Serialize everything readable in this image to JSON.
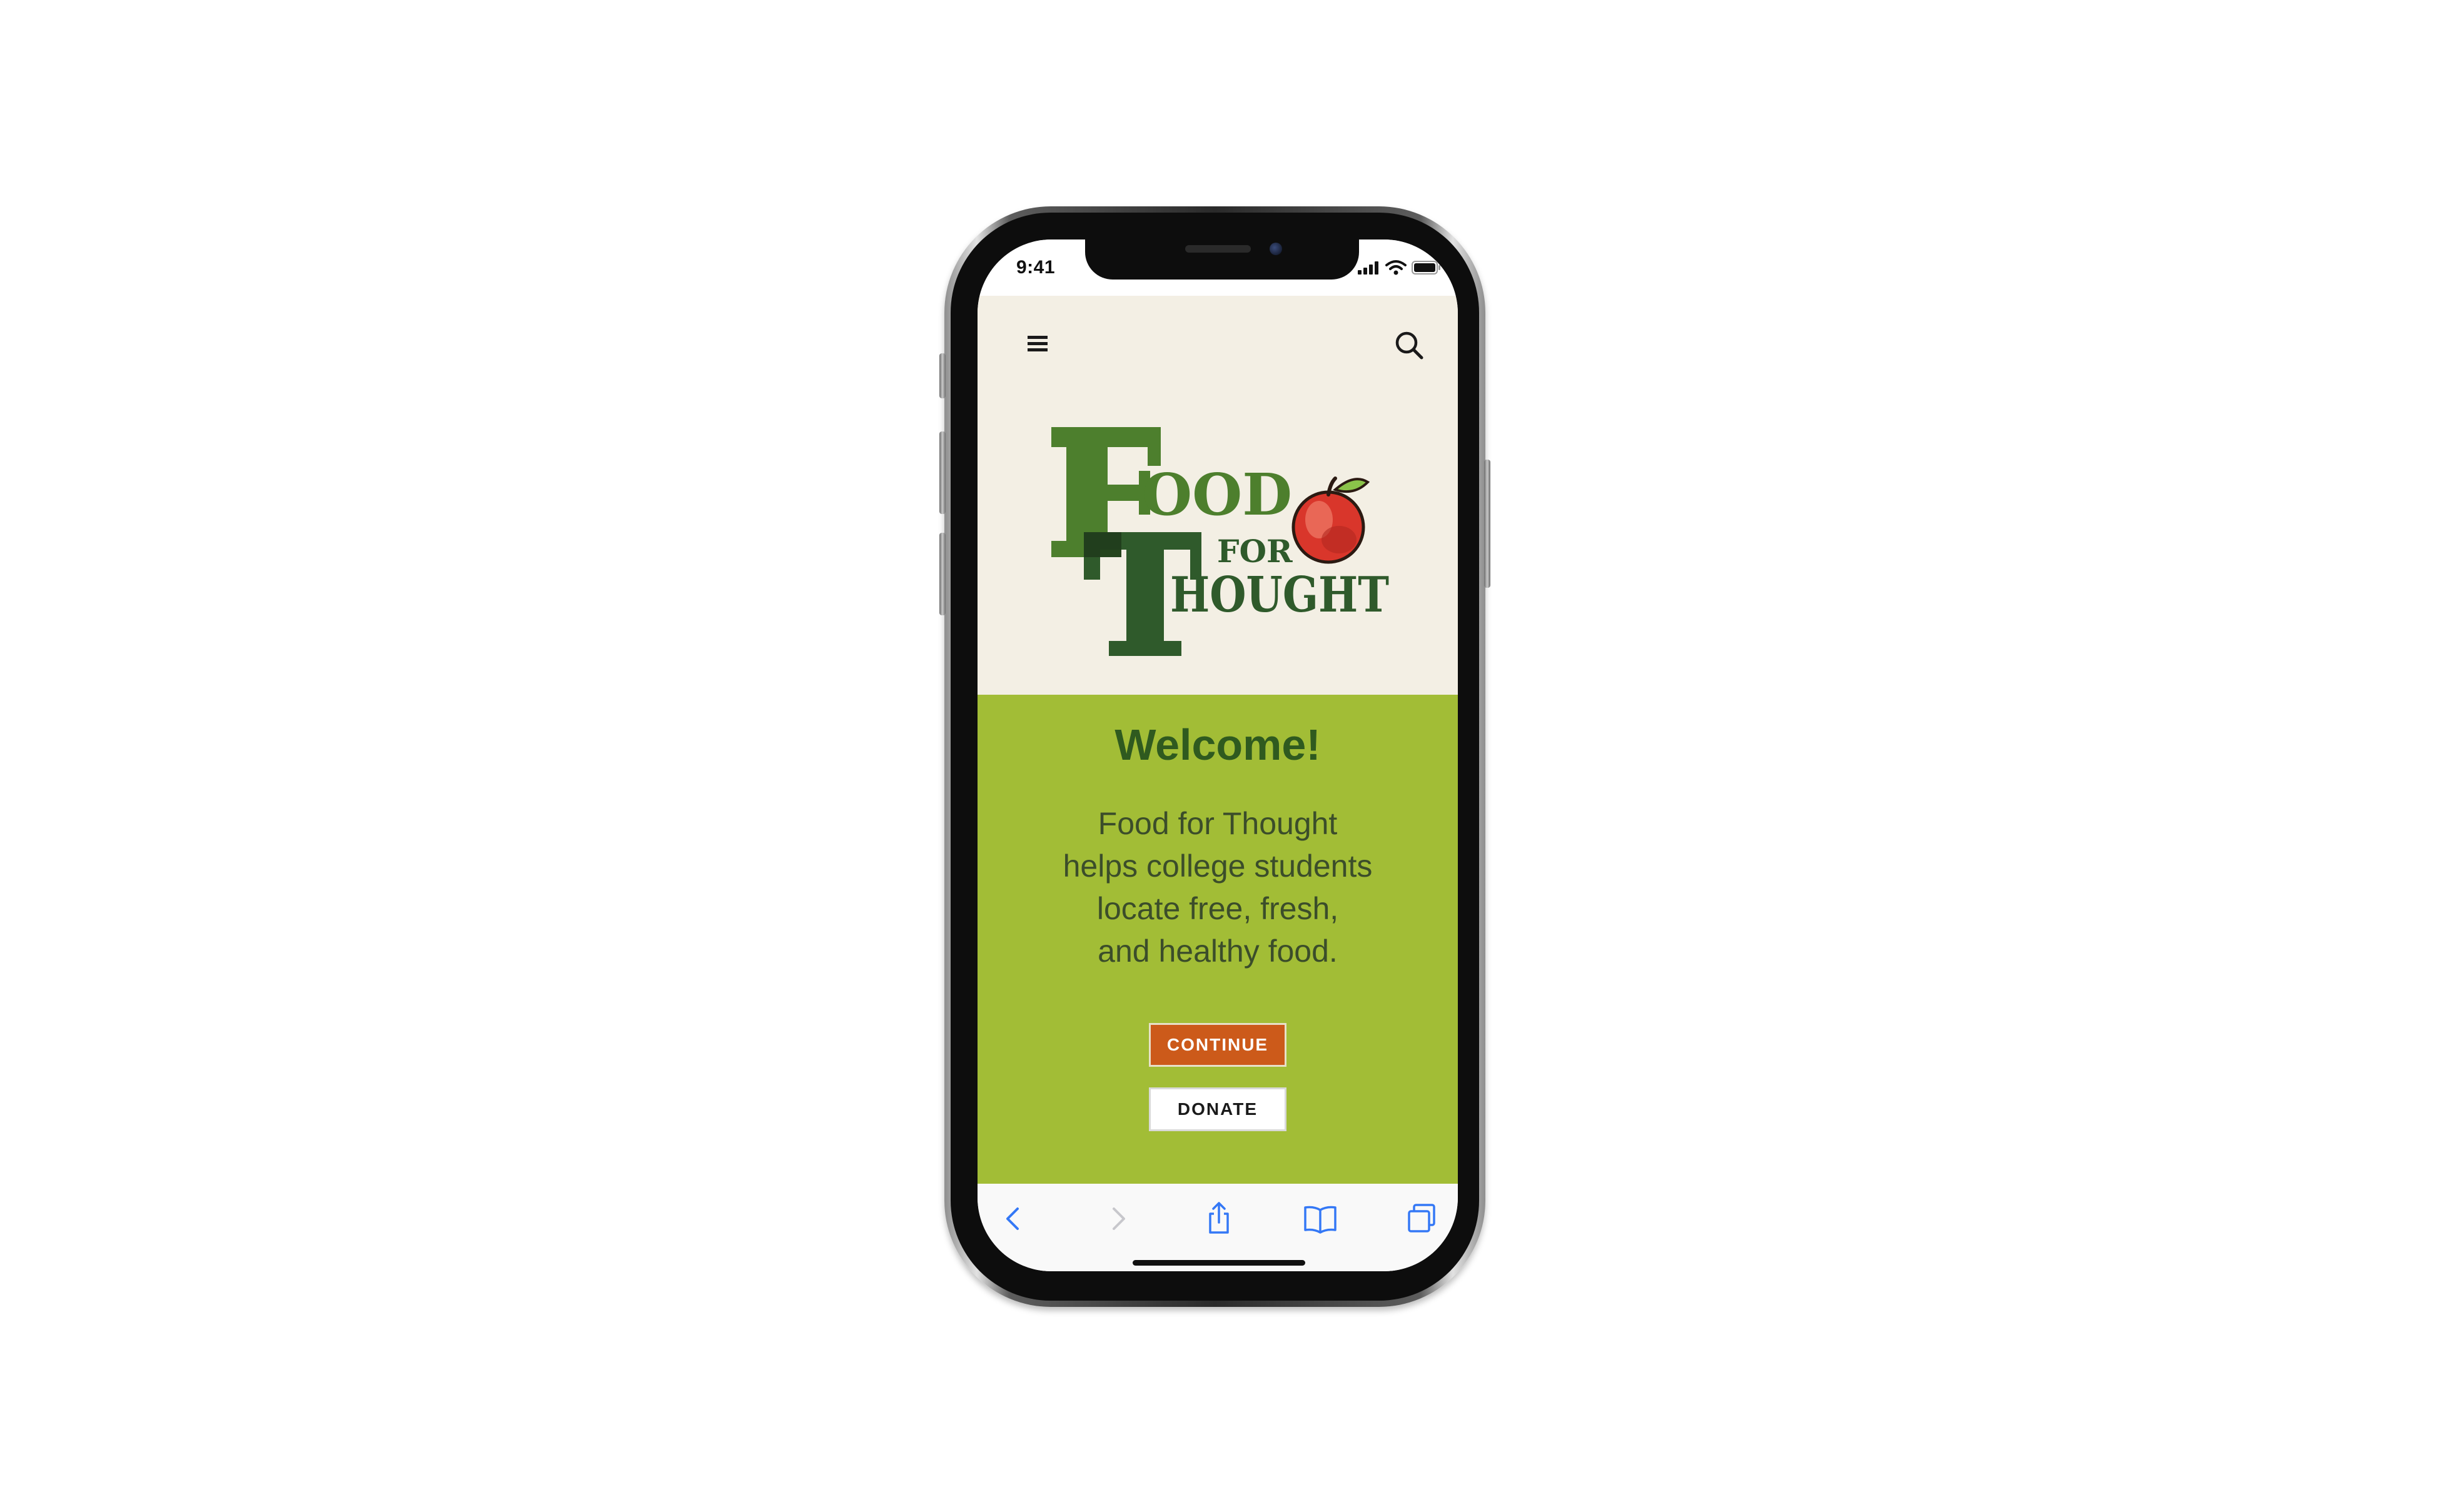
{
  "status_bar": {
    "time": "9:41"
  },
  "header": {
    "menu_icon": "hamburger-icon",
    "search_icon": "search-icon"
  },
  "logo": {
    "letter_f": "F",
    "word_ood": "OOD",
    "word_for": "FOR",
    "letter_t": "T",
    "word_hought": "HOUGHT"
  },
  "welcome": {
    "title": "Welcome!",
    "body_lines": [
      "Food for Thought",
      "helps college students",
      "locate free, fresh,",
      "and healthy food."
    ]
  },
  "buttons": {
    "continue_label": "CONTINUE",
    "donate_label": "DONATE"
  },
  "toolbar": {
    "icons": [
      "back-icon",
      "forward-icon",
      "share-icon",
      "bookmarks-icon",
      "tabs-icon"
    ]
  },
  "colors": {
    "header_bg": "#f3efe4",
    "panel_green": "#a2bd36",
    "title_green": "#2f5a1f",
    "continue_orange": "#cc5a1a",
    "safari_blue": "#3478f6"
  }
}
